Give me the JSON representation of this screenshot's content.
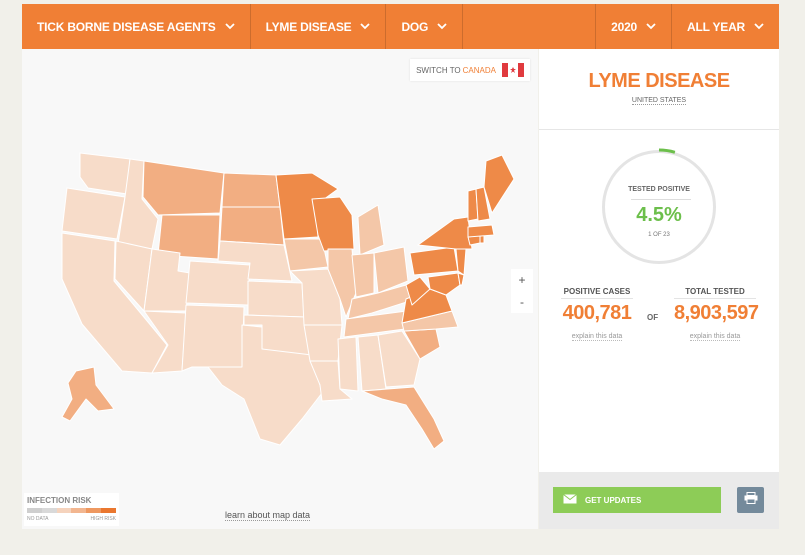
{
  "topbar": {
    "agent": "TICK BORNE DISEASE AGENTS",
    "disease": "LYME DISEASE",
    "species": "DOG",
    "year": "2020",
    "period": "ALL YEAR"
  },
  "map": {
    "switch_prefix": "SWITCH TO",
    "switch_country": "CANADA",
    "zoom_in": "+",
    "zoom_out": "-",
    "learn_link": "learn about map data",
    "legend": {
      "title": "INFECTION RISK",
      "low": "NO DATA",
      "high": "HIGH RISK",
      "colors": [
        "#cfcfcf",
        "#d9d9d9",
        "#f5d3bd",
        "#f2b690",
        "#ee9860",
        "#ea772f"
      ]
    },
    "colors": {
      "low": "#f7dcc9",
      "mid_low": "#f4c7a8",
      "mid": "#f2ae82",
      "high": "#ee8a48"
    }
  },
  "panel": {
    "title": "LYME DISEASE",
    "region": "UNITED STATES",
    "tested_positive_label": "TESTED POSITIVE",
    "percent": "4.5%",
    "percent_value": 0.045,
    "one_of": "1 OF 23",
    "positive_label": "POSITIVE CASES",
    "positive_value": "400,781",
    "of_label": "OF",
    "total_label": "TOTAL TESTED",
    "total_value": "8,903,597",
    "explain": "explain this data",
    "get_updates": "GET UPDATES"
  },
  "accent": "#f07f35",
  "positive_color": "#6cbf4b"
}
